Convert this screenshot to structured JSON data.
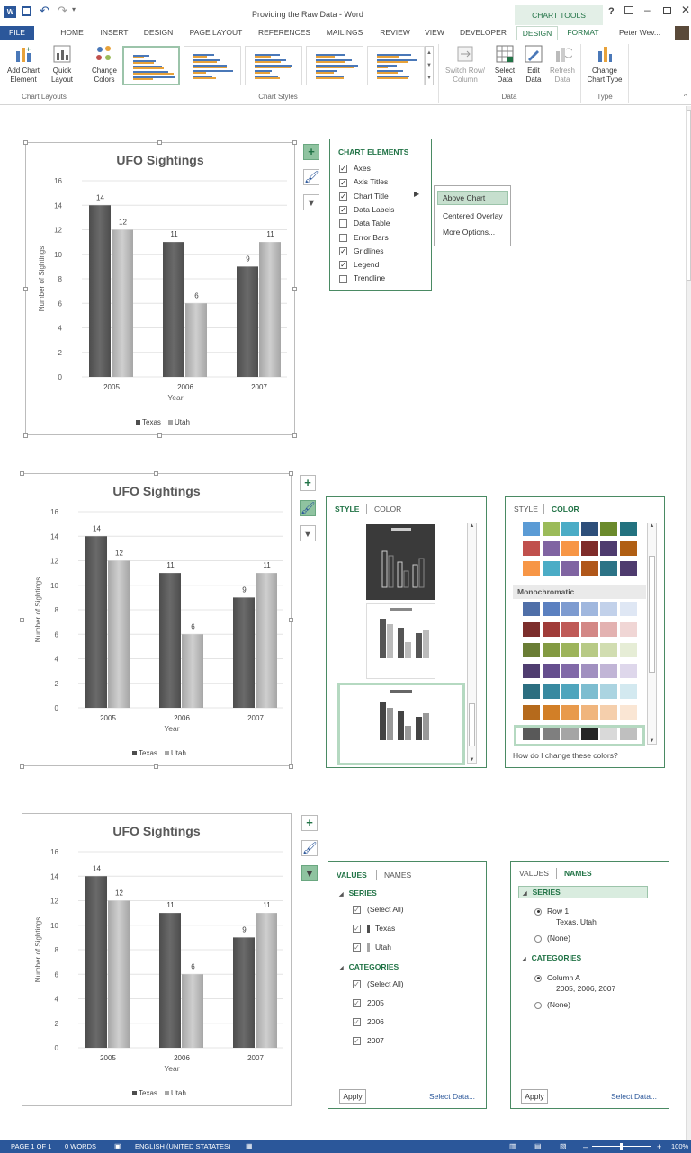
{
  "window": {
    "title": "Providing the Raw Data - Word",
    "context_tab": "CHART TOOLS",
    "user": "Peter Wev...",
    "help": "?"
  },
  "tabs": [
    "FILE",
    "HOME",
    "INSERT",
    "DESIGN",
    "PAGE LAYOUT",
    "REFERENCES",
    "MAILINGS",
    "REVIEW",
    "VIEW",
    "DEVELOPER",
    "DESIGN",
    "FORMAT"
  ],
  "ribbon": {
    "add_chart_element": "Add Chart\nElement",
    "quick_layout": "Quick\nLayout",
    "change_colors": "Change\nColors",
    "switch_row_column": "Switch Row/\nColumn",
    "select_data": "Select\nData",
    "edit_data": "Edit\nData",
    "refresh_data": "Refresh\nData",
    "change_chart_type": "Change\nChart Type",
    "groups": {
      "chart_layouts": "Chart Layouts",
      "chart_styles": "Chart Styles",
      "data": "Data",
      "type": "Type"
    }
  },
  "chart_data": [
    {
      "type": "bar",
      "title": "UFO Sightings",
      "xlabel": "Year",
      "ylabel": "Number of Sightings",
      "categories": [
        "2005",
        "2006",
        "2007"
      ],
      "series": [
        {
          "name": "Texas",
          "values": [
            14,
            11,
            9
          ],
          "color": "#4d4d4d"
        },
        {
          "name": "Utah",
          "values": [
            12,
            6,
            11
          ],
          "color": "#a6a6a6"
        }
      ],
      "ylim": [
        0,
        16
      ],
      "yticks": [
        "0",
        "2",
        "4",
        "6",
        "8",
        "10",
        "12",
        "14",
        "16"
      ],
      "legend_position": "bottom",
      "grid": true
    },
    {
      "type": "bar",
      "title": "UFO Sightings",
      "xlabel": "Year",
      "ylabel": "Number of Sightings",
      "categories": [
        "2005",
        "2006",
        "2007"
      ],
      "series": [
        {
          "name": "Texas",
          "values": [
            14,
            11,
            9
          ],
          "color": "#4d4d4d"
        },
        {
          "name": "Utah",
          "values": [
            12,
            6,
            11
          ],
          "color": "#a6a6a6"
        }
      ],
      "ylim": [
        0,
        16
      ],
      "yticks": [
        "0",
        "2",
        "4",
        "6",
        "8",
        "10",
        "12",
        "14",
        "16"
      ],
      "legend_position": "bottom",
      "grid": true
    },
    {
      "type": "bar",
      "title": "UFO Sightings",
      "xlabel": "Year",
      "ylabel": "Number of Sightings",
      "categories": [
        "2005",
        "2006",
        "2007"
      ],
      "series": [
        {
          "name": "Texas",
          "values": [
            14,
            11,
            9
          ],
          "color": "#4d4d4d"
        },
        {
          "name": "Utah",
          "values": [
            12,
            6,
            11
          ],
          "color": "#a6a6a6"
        }
      ],
      "ylim": [
        0,
        16
      ],
      "yticks": [
        "0",
        "2",
        "4",
        "6",
        "8",
        "10",
        "12",
        "14",
        "16"
      ],
      "legend_position": "bottom",
      "grid": true
    }
  ],
  "chart_elements": {
    "title": "CHART ELEMENTS",
    "items": [
      {
        "label": "Axes",
        "checked": true
      },
      {
        "label": "Axis Titles",
        "checked": true
      },
      {
        "label": "Chart Title",
        "checked": true
      },
      {
        "label": "Data Labels",
        "checked": true
      },
      {
        "label": "Data Table",
        "checked": false
      },
      {
        "label": "Error Bars",
        "checked": false
      },
      {
        "label": "Gridlines",
        "checked": true
      },
      {
        "label": "Legend",
        "checked": true
      },
      {
        "label": "Trendline",
        "checked": false
      }
    ],
    "submenu": [
      "Above Chart",
      "Centered Overlay",
      "More Options..."
    ]
  },
  "style_panel": {
    "tab_style": "STYLE",
    "tab_color": "COLOR"
  },
  "color_panel": {
    "tab_style": "STYLE",
    "tab_color": "COLOR",
    "section": "Monochromatic",
    "help": "How do I change these colors?",
    "colorful_rows": [
      [
        "#5b9bd5",
        "#9bbb59",
        "#4bacc6",
        "#2e4f7a",
        "#6b8a2c",
        "#23727f"
      ],
      [
        "#c0504d",
        "#8064a2",
        "#f79646",
        "#7f2c2a",
        "#4e3b6e",
        "#b05f14"
      ],
      [
        "#f79646",
        "#4bacc6",
        "#8064a2",
        "#b0571a",
        "#2c7386",
        "#4e3b6e"
      ]
    ],
    "mono_rows": [
      [
        "#4f6fa8",
        "#5b80c0",
        "#7d9bd0",
        "#a0b7de",
        "#c2d1ea",
        "#dfe7f4"
      ],
      [
        "#7c2e2c",
        "#a03c39",
        "#bf5a57",
        "#d38886",
        "#e3b2b1",
        "#f0d6d5"
      ],
      [
        "#6a7d35",
        "#839a42",
        "#9db45b",
        "#b8ca86",
        "#d1ddb1",
        "#e6edd6"
      ],
      [
        "#4f3d70",
        "#654e8e",
        "#8169a8",
        "#a190c0",
        "#c1b5d6",
        "#ded7eb"
      ],
      [
        "#2c6e80",
        "#3889a0",
        "#4fa5bd",
        "#7dbdd0",
        "#abd4e1",
        "#d3e9f0"
      ],
      [
        "#b56a1c",
        "#d27f27",
        "#e89a4c",
        "#f0b57d",
        "#f5cfac",
        "#fae6d4"
      ],
      [
        "#595959",
        "#7f7f7f",
        "#a5a5a5",
        "#262626",
        "#d9d9d9",
        "#bfbfbf"
      ]
    ]
  },
  "values_panel": {
    "tab_values": "VALUES",
    "tab_names": "NAMES",
    "series_header": "SERIES",
    "series": [
      "(Select All)",
      "Texas",
      "Utah"
    ],
    "categories_header": "CATEGORIES",
    "categories": [
      "(Select All)",
      "2005",
      "2006",
      "2007"
    ],
    "apply": "Apply",
    "select_data": "Select Data..."
  },
  "names_panel": {
    "tab_values": "VALUES",
    "tab_names": "NAMES",
    "series_header": "SERIES",
    "series_option": "Row 1",
    "series_option_detail": "Texas, Utah",
    "none": "(None)",
    "categories_header": "CATEGORIES",
    "categories_option": "Column A",
    "categories_option_detail": "2005, 2006, 2007",
    "apply": "Apply",
    "select_data": "Select Data..."
  },
  "status": {
    "page": "PAGE 1 OF 1",
    "words": "0 WORDS",
    "language": "ENGLISH (UNITED STATATES)",
    "zoom": "100%"
  }
}
